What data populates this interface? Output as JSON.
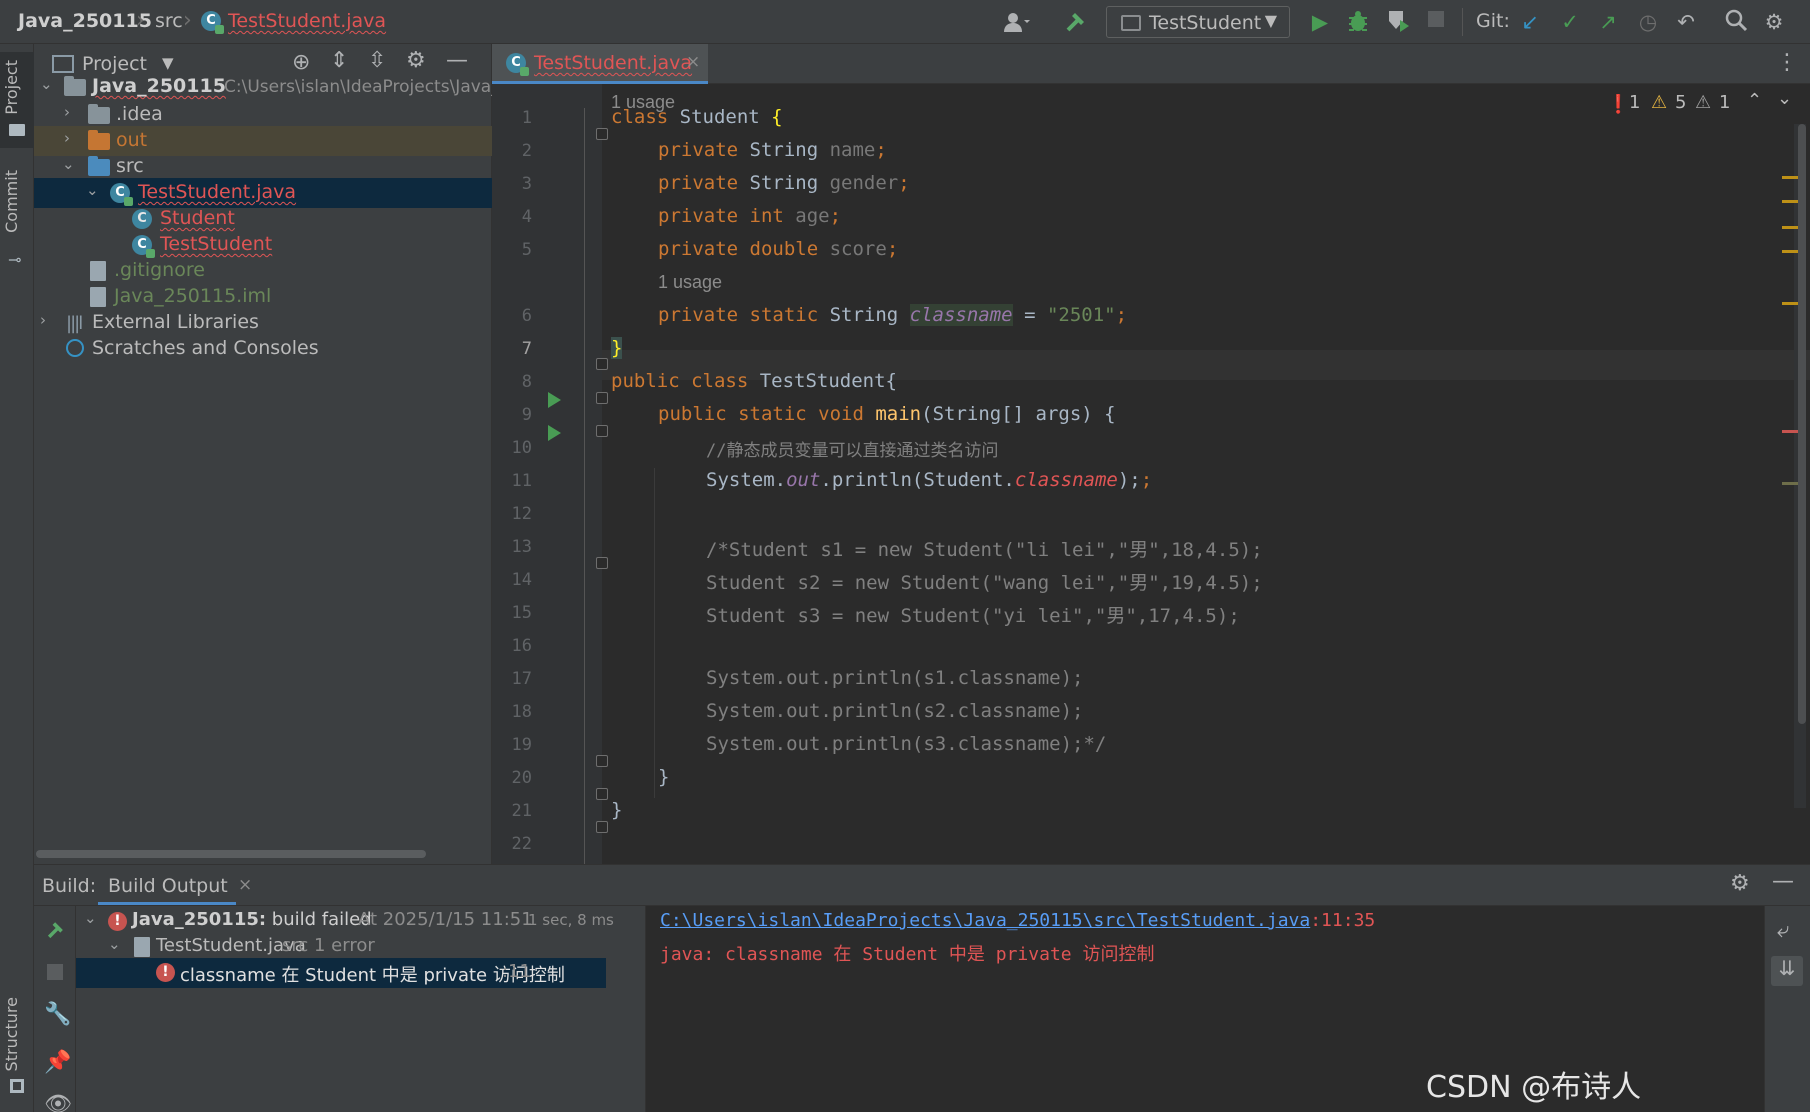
{
  "breadcrumb": {
    "project": "Java_250115",
    "folder": "src",
    "file": "TestStudent.java"
  },
  "toolbar": {
    "run_config": "TestStudent",
    "git_label": "Git:"
  },
  "left_strip": {
    "project_tab": "Project",
    "commit_tab": "Commit",
    "structure_tab": "Structure"
  },
  "project_panel": {
    "title": "Project",
    "tree": [
      {
        "label": "Java_250115",
        "path": "C:\\Users\\islan\\IdeaProjects\\Java_250115"
      },
      {
        "label": ".idea"
      },
      {
        "label": "out"
      },
      {
        "label": "src"
      },
      {
        "label": "TestStudent.java"
      },
      {
        "label": "Student"
      },
      {
        "label": "TestStudent"
      },
      {
        "label": ".gitignore"
      },
      {
        "label": "Java_250115.iml"
      },
      {
        "label": "External Libraries"
      },
      {
        "label": "Scratches and Consoles"
      }
    ]
  },
  "editor": {
    "tab_label": "TestStudent.java",
    "usage_hint_1": "1 usage",
    "usage_hint_2": "1 usage",
    "inspections": {
      "errors": "1",
      "warnings": "5",
      "weak_warnings": "1"
    },
    "line_numbers": [
      "1",
      "2",
      "3",
      "4",
      "5",
      "6",
      "7",
      "8",
      "9",
      "10",
      "11",
      "12",
      "13",
      "14",
      "15",
      "16",
      "17",
      "18",
      "19",
      "20",
      "21",
      "22"
    ],
    "code": {
      "l1": {
        "kw": "class",
        "name": " Student ",
        "brace": "{"
      },
      "l2": {
        "kw": "private",
        "type": " String ",
        "field": "name",
        "end": ";"
      },
      "l3": {
        "kw": "private",
        "type": " String ",
        "field": "gender",
        "end": ";"
      },
      "l4": {
        "kw": "private int",
        "type": " ",
        "field": "age",
        "end": ";"
      },
      "l5": {
        "kw": "private double",
        "type": " ",
        "field": "score",
        "end": ";"
      },
      "l6": {
        "kw": "private static",
        "type": " String ",
        "field": "classname",
        "eq": " = ",
        "str": "\"2501\"",
        "end": ";"
      },
      "l7": {
        "brace": "}"
      },
      "l8": {
        "kw": "public class",
        "rest": " TestStudent{"
      },
      "l9": {
        "kw": "public static void",
        "sp": " ",
        "fn": "main",
        "rest": "(String[] args) {"
      },
      "l10": {
        "comment": "//静态成员变量可以直接通过类名访问"
      },
      "l11": {
        "a": "System.",
        "b": "out",
        "c": ".println(Student.",
        "d": "classname",
        "e": ");"
      },
      "l13": "/*Student s1 = new Student(\"li lei\",\"男\",18,4.5);",
      "l14": "Student s2 = new Student(\"wang lei\",\"男\",19,4.5);",
      "l15": "Student s3 = new Student(\"yi lei\",\"男\",17,4.5);",
      "l17": "System.out.println(s1.classname);",
      "l18": "System.out.println(s2.classname);",
      "l19": "System.out.println(s3.classname);*/",
      "l20": "}",
      "l21": "}"
    }
  },
  "build": {
    "label": "Build:",
    "tab": "Build Output",
    "tree": {
      "root": "Java_250115:",
      "root_status": " build failed",
      "root_time": "At 2025/1/15 11:51",
      "root_duration": "1 sec, 8 ms",
      "file": "TestStudent.java",
      "file_detail": "src 1 error",
      "error": "classname 在 Student 中是 private 访问控制",
      "error_line": ":11"
    },
    "output": {
      "path": "C:\\Users\\islan\\IdeaProjects\\Java_250115\\src\\TestStudent.java",
      "pos": ":11:35",
      "message": "java: classname 在 Student 中是 private 访问控制"
    }
  },
  "watermark": "CSDN @布诗人",
  "colors": {
    "keyword": "#cc7832",
    "field": "#9876aa",
    "string": "#6a8759",
    "comment": "#808080",
    "error": "#c75450",
    "link": "#589df6"
  }
}
